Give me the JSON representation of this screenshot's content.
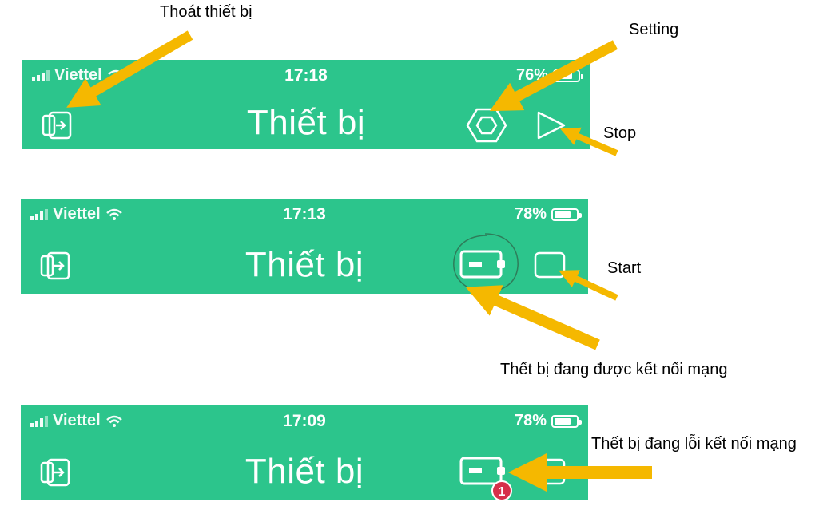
{
  "screens": [
    {
      "status": {
        "carrier": "Viettel",
        "time": "17:18",
        "battery": "76%",
        "battery_level": 0.76
      },
      "title": "Thiết bị",
      "icons": [
        "exit-device-icon",
        "settings-hexagon-icon",
        "play-icon"
      ]
    },
    {
      "status": {
        "carrier": "Viettel",
        "time": "17:13",
        "battery": "78%",
        "battery_level": 0.78
      },
      "title": "Thiết bị",
      "icons": [
        "exit-device-icon",
        "device-connected-icon",
        "stop-square-icon"
      ]
    },
    {
      "status": {
        "carrier": "Viettel",
        "time": "17:09",
        "battery": "78%",
        "battery_level": 0.78
      },
      "title": "Thiết bị",
      "icons": [
        "exit-device-icon",
        "device-error-icon",
        "stop-square-icon"
      ],
      "error_badge": "1"
    }
  ],
  "annotations": {
    "exit_device": "Thoát thiết bị",
    "setting": "Setting",
    "stop": "Stop",
    "start": "Start",
    "connected": "Thết bị đang được kết nối mạng",
    "error": "Thết bị đang lỗi kết nối mạng"
  },
  "colors": {
    "header_green": "#2cc58c",
    "arrow": "#f5b800",
    "badge": "#d6304a"
  }
}
